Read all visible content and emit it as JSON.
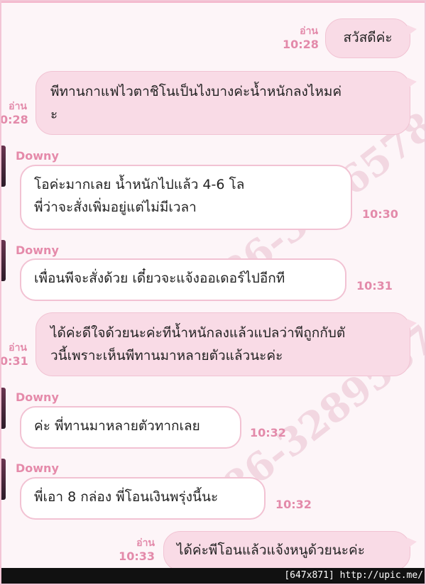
{
  "watermarks": [
    "086-3196578",
    "086-3289587"
  ],
  "footer": "[647x871] http://upic.me/",
  "messages": [
    {
      "read": "อ่าน",
      "time": "10:28",
      "lines": [
        "สวัสดีค่ะ"
      ]
    },
    {
      "read": "อ่าน",
      "time": "0:28",
      "lines": [
        "พีทานกาแฟไวตาชิโนเป็นไงบางค่ะน้ำหนักลงไหมค่",
        "ะ"
      ]
    },
    {
      "sender": "Downy",
      "time": "10:30",
      "lines": [
        "โอค่ะมากเลย น้ำหนักไปแล้ว 4-6 โล",
        "พี่ว่าจะสั่งเพิ่มอยู่แต่ไม่มีเวลา"
      ]
    },
    {
      "sender": "Downy",
      "time": "10:31",
      "lines": [
        "เพื่อนพีจะสั่งด้วย เดี๋ยวจะแจ้งออเดอร์ไปอีกที"
      ]
    },
    {
      "read": "อ่าน",
      "time": "0:31",
      "lines": [
        "ได้ค่ะดีใจด้วยนะค่ะทีน้ำหนักลงแล้วแปลว่าพีถูกกับตั",
        "วนี้เพราะเห็นพีทานมาหลายตัวแล้วนะค่ะ"
      ]
    },
    {
      "sender": "Downy",
      "time": "10:32",
      "lines": [
        "ค่ะ พี่ทานมาหลายตัวทากเลย"
      ]
    },
    {
      "sender": "Downy",
      "time": "10:32",
      "lines": [
        "พี่เอา 8 กล่อง พี่โอนเงินพรุ่งนี้นะ"
      ]
    },
    {
      "read": "อ่าน",
      "time": "10:33",
      "lines": [
        "ได้ค่ะพีโอนแล้วแจ้งหนูด้วยนะค่ะ"
      ]
    }
  ]
}
